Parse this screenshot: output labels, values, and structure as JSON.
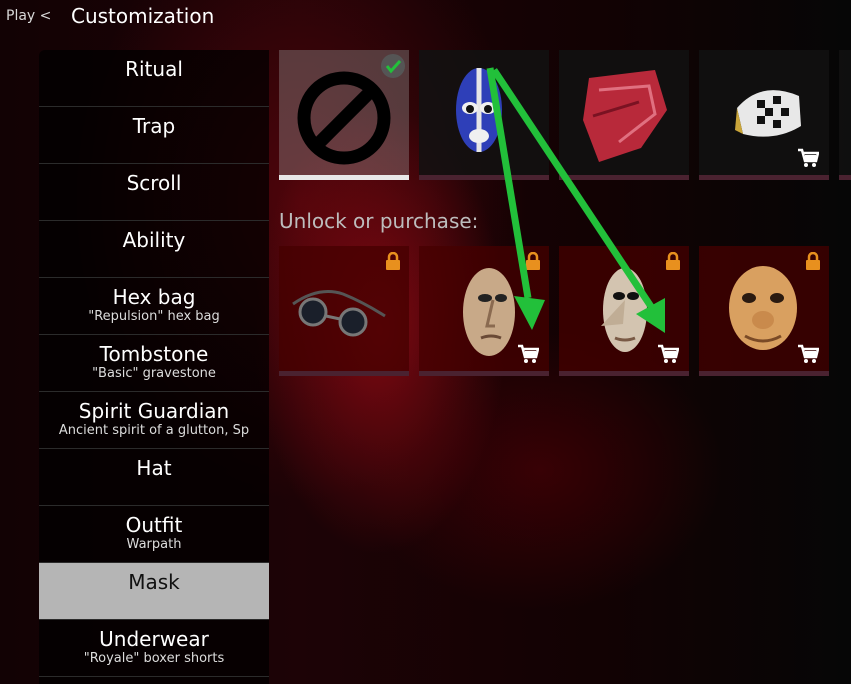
{
  "header": {
    "back_label": "Play <",
    "title": "Customization"
  },
  "sidebar": {
    "items": [
      {
        "label": "Ritual",
        "sub": ""
      },
      {
        "label": "Trap",
        "sub": ""
      },
      {
        "label": "Scroll",
        "sub": ""
      },
      {
        "label": "Ability",
        "sub": ""
      },
      {
        "label": "Hex bag",
        "sub": "\"Repulsion\" hex bag"
      },
      {
        "label": "Tombstone",
        "sub": "\"Basic\" gravestone"
      },
      {
        "label": "Spirit Guardian",
        "sub": "Ancient spirit of a glutton, Sp"
      },
      {
        "label": "Hat",
        "sub": ""
      },
      {
        "label": "Outfit",
        "sub": "Warpath"
      },
      {
        "label": "Mask",
        "sub": ""
      },
      {
        "label": "Underwear",
        "sub": "\"Royale\" boxer shorts"
      }
    ],
    "active": "Mask"
  },
  "owned": [
    {
      "icon": "no-mask-icon",
      "state": "selected"
    },
    {
      "icon": "luchador-mask-icon",
      "state": "owned"
    },
    {
      "icon": "red-bandana-icon",
      "state": "owned"
    },
    {
      "icon": "harlequin-mask-icon",
      "state": "purchasable"
    }
  ],
  "unlock_label": "Unlock or purchase:",
  "locked": [
    {
      "icon": "goggles-icon",
      "state": "locked"
    },
    {
      "icon": "old-man-mask-icon",
      "state": "locked-purchasable"
    },
    {
      "icon": "long-nose-mask-icon",
      "state": "locked-purchasable"
    },
    {
      "icon": "comedy-mask-icon",
      "state": "locked-purchasable"
    }
  ],
  "colors": {
    "accent_green": "#22c03a",
    "lock_orange": "#e8901e",
    "active_tab": "#b5b5b5"
  }
}
